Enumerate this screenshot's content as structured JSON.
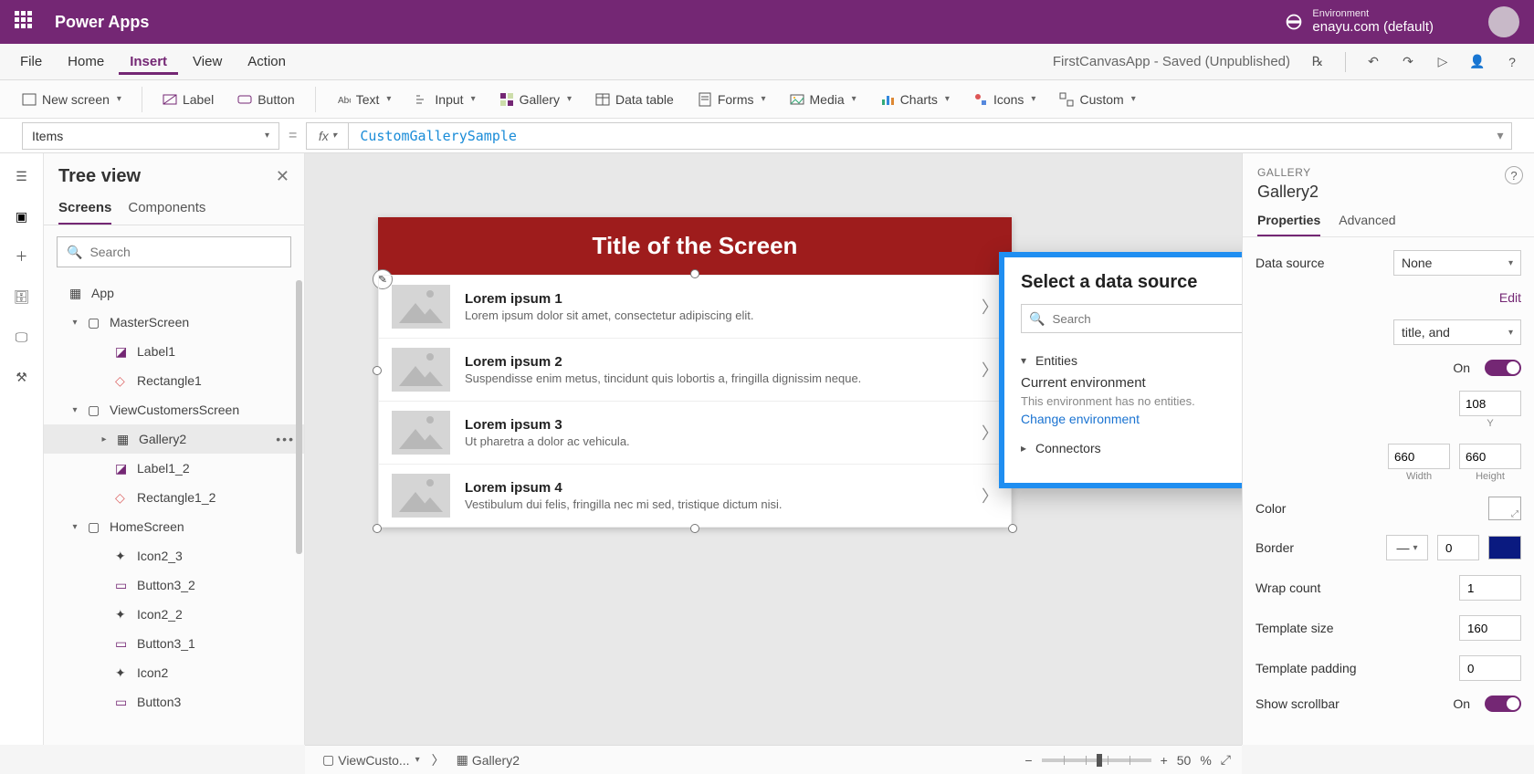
{
  "brand": "Power Apps",
  "environment": {
    "label": "Environment",
    "name": "enayu.com (default)"
  },
  "menu": {
    "file": "File",
    "home": "Home",
    "insert": "Insert",
    "view": "View",
    "action": "Action"
  },
  "docTitle": "FirstCanvasApp - Saved (Unpublished)",
  "ribbon": {
    "newScreen": "New screen",
    "label": "Label",
    "button": "Button",
    "text": "Text",
    "input": "Input",
    "gallery": "Gallery",
    "dataTable": "Data table",
    "forms": "Forms",
    "media": "Media",
    "charts": "Charts",
    "icons": "Icons",
    "custom": "Custom"
  },
  "formula": {
    "property": "Items",
    "value": "CustomGallerySample"
  },
  "tree": {
    "title": "Tree view",
    "tabs": {
      "screens": "Screens",
      "components": "Components"
    },
    "searchPlaceholder": "Search",
    "nodes": {
      "app": "App",
      "master": "MasterScreen",
      "label1": "Label1",
      "rect1": "Rectangle1",
      "viewCust": "ViewCustomersScreen",
      "gallery2": "Gallery2",
      "label1_2": "Label1_2",
      "rect1_2": "Rectangle1_2",
      "home": "HomeScreen",
      "icon2_3": "Icon2_3",
      "btn3_2": "Button3_2",
      "icon2_2": "Icon2_2",
      "btn3_1": "Button3_1",
      "icon2": "Icon2",
      "btn3": "Button3"
    }
  },
  "canvas": {
    "header": "Title of the Screen",
    "rows": [
      {
        "t": "Lorem ipsum 1",
        "s": "Lorem ipsum dolor sit amet, consectetur adipiscing elit."
      },
      {
        "t": "Lorem ipsum 2",
        "s": "Suspendisse enim metus, tincidunt quis lobortis a, fringilla dignissim neque."
      },
      {
        "t": "Lorem ipsum 3",
        "s": "Ut pharetra a dolor ac vehicula."
      },
      {
        "t": "Lorem ipsum 4",
        "s": "Vestibulum dui felis, fringilla nec mi sed, tristique dictum nisi."
      }
    ]
  },
  "dsPopup": {
    "title": "Select a data source",
    "searchPlaceholder": "Search",
    "entities": "Entities",
    "currentEnv": "Current environment",
    "noEntities": "This environment has no entities.",
    "changeEnv": "Change environment",
    "connectors": "Connectors"
  },
  "props": {
    "sectionLabel": "GALLERY",
    "name": "Gallery2",
    "tabs": {
      "properties": "Properties",
      "advanced": "Advanced"
    },
    "dataSource": {
      "label": "Data source",
      "value": "None"
    },
    "edit": "Edit",
    "layoutHint": "title, and",
    "visible": {
      "on": "On"
    },
    "pos": {
      "y": "108",
      "yl": "Y",
      "w": "660",
      "wl": "Width",
      "h": "660",
      "hl": "Height"
    },
    "color": {
      "label": "Color"
    },
    "border": {
      "label": "Border",
      "width": "0"
    },
    "wrap": {
      "label": "Wrap count",
      "value": "1"
    },
    "tsize": {
      "label": "Template size",
      "value": "160"
    },
    "tpad": {
      "label": "Template padding",
      "value": "0"
    },
    "scroll": {
      "label": "Show scrollbar",
      "on": "On"
    }
  },
  "status": {
    "screen": "ViewCusto...",
    "control": "Gallery2",
    "zoom": "50",
    "pct": "%"
  }
}
